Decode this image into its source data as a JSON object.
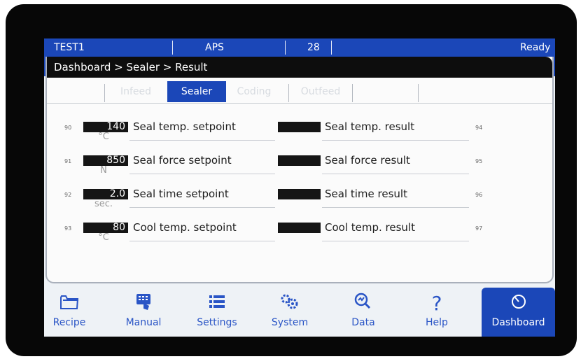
{
  "status": {
    "name": "TEST1",
    "mode": "APS",
    "count": "28",
    "state": "Ready"
  },
  "breadcrumb": "Dashboard > Sealer > Result",
  "tabs": [
    {
      "label": "Infeed",
      "active": false
    },
    {
      "label": "Sealer",
      "active": true
    },
    {
      "label": "Coding",
      "active": false
    },
    {
      "label": "Outfeed",
      "active": false
    }
  ],
  "setpoints": [
    {
      "num": "90",
      "value": "140",
      "unit": "°C",
      "label": "Seal temp. setpoint"
    },
    {
      "num": "91",
      "value": "850",
      "unit": "N",
      "label": "Seal force setpoint"
    },
    {
      "num": "92",
      "value": "2.0",
      "unit": "sec.",
      "label": "Seal time setpoint"
    },
    {
      "num": "93",
      "value": "80",
      "unit": "°C",
      "label": "Cool temp. setpoint"
    }
  ],
  "results": [
    {
      "num": "94",
      "label": "Seal temp. result"
    },
    {
      "num": "95",
      "label": "Seal force result"
    },
    {
      "num": "96",
      "label": "Seal time result"
    },
    {
      "num": "97",
      "label": "Cool temp. result"
    }
  ],
  "nav": [
    {
      "label": "Recipe",
      "icon": "folder-icon"
    },
    {
      "label": "Manual",
      "icon": "keypad-hand-icon"
    },
    {
      "label": "Settings",
      "icon": "list-icon"
    },
    {
      "label": "System",
      "icon": "gears-icon"
    },
    {
      "label": "Data",
      "icon": "search-chart-icon"
    },
    {
      "label": "Help",
      "icon": "question-icon"
    },
    {
      "label": "Dashboard",
      "icon": "gauge-icon",
      "active": true
    }
  ],
  "colors": {
    "accent": "#1b47b8",
    "navText": "#2a55c6",
    "bezel": "#070707"
  }
}
